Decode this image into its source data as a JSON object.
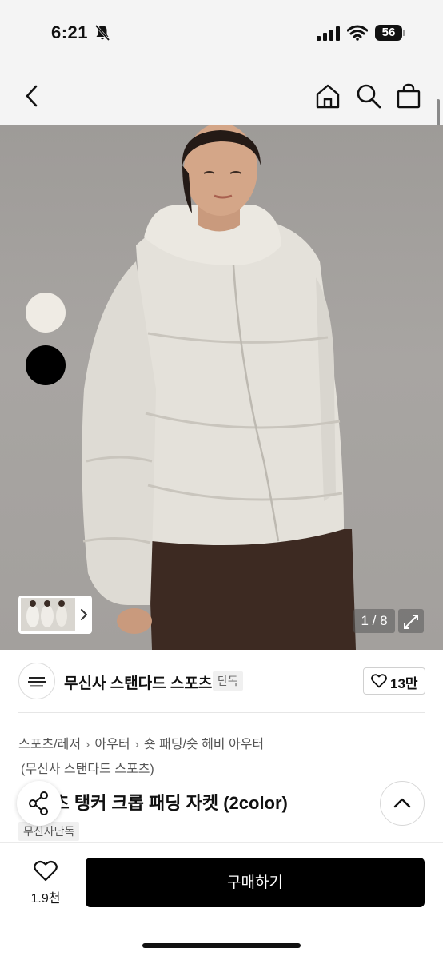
{
  "status_bar": {
    "time": "6:21",
    "battery": "56"
  },
  "hero": {
    "page_indicator": "1 / 8"
  },
  "brand": {
    "name": "무신사 스탠다드 스포츠",
    "tag": "단독",
    "like_count": "13만"
  },
  "breadcrumb": [
    "스포츠/레저",
    "아우터",
    "숏 패딩/숏 헤비 아우터"
  ],
  "product": {
    "brand_line": "(무신사 스탠다드 스포츠)",
    "title": "스포츠 탱커 크롭 패딩 자켓 (2color)",
    "exclusive_tag": "무신사단독"
  },
  "color_swatches": [
    "#efebe4",
    "#000000"
  ],
  "bottom_bar": {
    "wishlist_count": "1.9천",
    "buy_label": "구매하기"
  },
  "colors": {
    "accent": "#000000",
    "status_bg": "#f4f4f4"
  }
}
